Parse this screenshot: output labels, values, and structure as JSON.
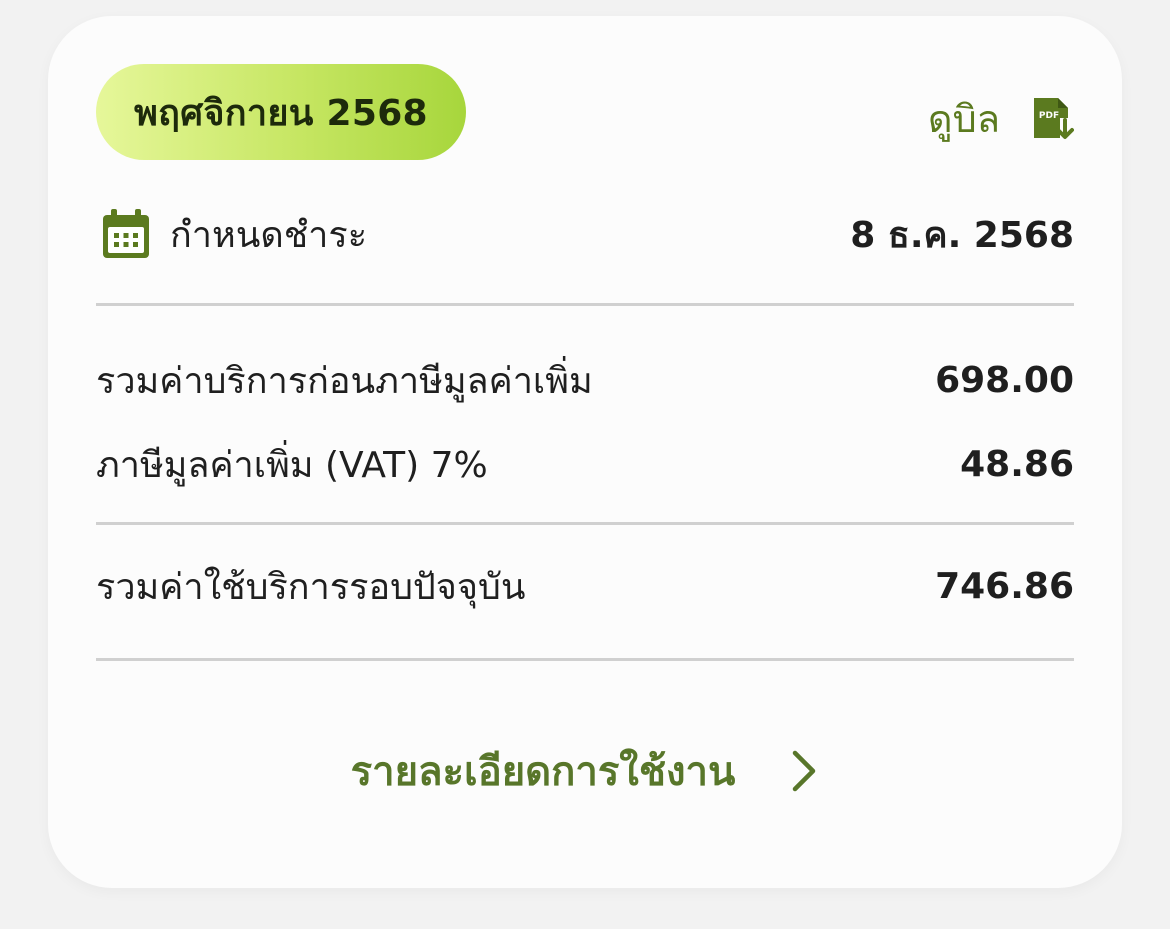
{
  "bill": {
    "month_label": "พฤศจิกายน 2568",
    "view_bill_label": "ดูบิล",
    "pdf_icon_text": "PDF",
    "due": {
      "label": "กำหนดชำระ",
      "value": "8 ธ.ค. 2568"
    },
    "lines": [
      {
        "label": "รวมค่าบริการก่อนภาษีมูลค่าเพิ่ม",
        "value": "698.00"
      },
      {
        "label": "ภาษีมูลค่าเพิ่ม (VAT) 7%",
        "value": "48.86"
      }
    ],
    "total": {
      "label": "รวมค่าใช้บริการรอบปัจจุบัน",
      "value": "746.86"
    },
    "details_link_label": "รายละเอียดการใช้งาน"
  },
  "icons": {
    "pdf": "pdf-download-icon",
    "calendar": "calendar-icon",
    "chevron": "chevron-right-icon"
  },
  "colors": {
    "accent_green": "#5b7a1f",
    "pill_gradient_start": "#e6f79a",
    "pill_gradient_end": "#a7d63c",
    "divider": "#d0d0d0",
    "card_background": "#fcfcfc"
  }
}
